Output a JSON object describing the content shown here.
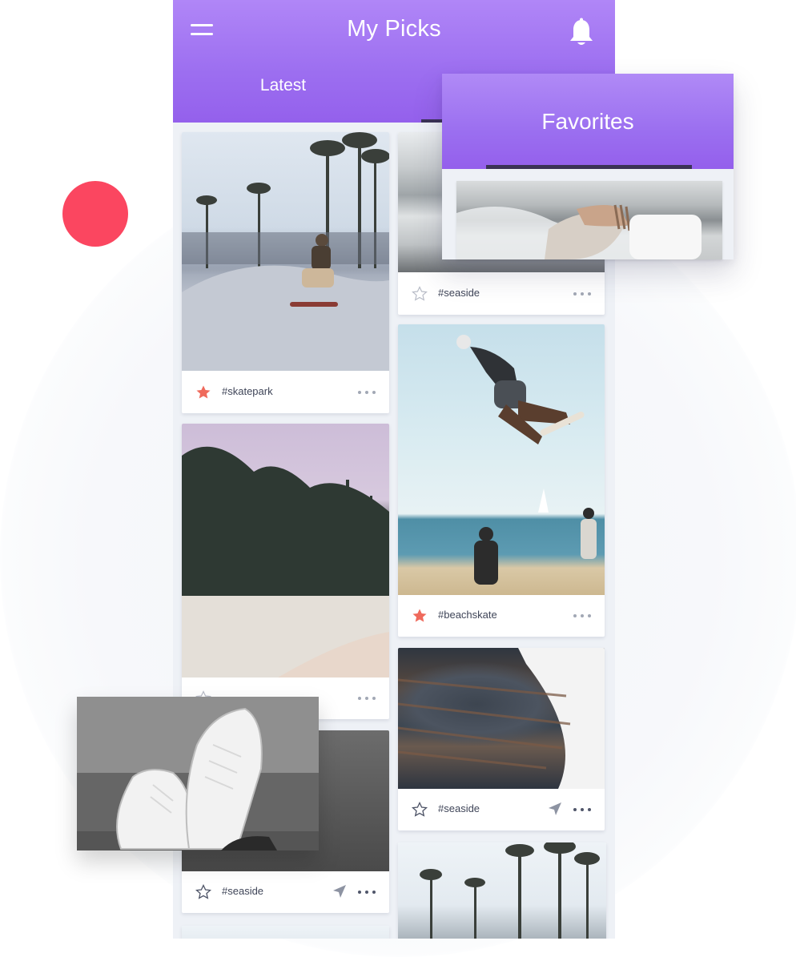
{
  "app": {
    "title": "My Picks",
    "tabs": {
      "latest": "Latest",
      "favorites": "Favorites"
    }
  },
  "icons": {
    "menu": "menu-icon",
    "bell": "bell-icon",
    "star_filled": "star-filled-icon",
    "star_outline": "star-outline-icon",
    "send": "send-icon",
    "more": "more-dots-icon"
  },
  "colors": {
    "header_gradient_top": "#b086f7",
    "header_gradient_bottom": "#9460ec",
    "accent_dot": "#fb4660",
    "star_filled": "#ef6a5c",
    "tab_indicator": "#3b3256"
  },
  "feed": {
    "left_column": [
      {
        "tag": "#skatepark",
        "starred": true
      },
      {
        "tag": "",
        "starred": false
      },
      {
        "tag": "#seaside",
        "starred": false
      }
    ],
    "right_column": [
      {
        "tag": "#seaside",
        "starred": false
      },
      {
        "tag": "#beachskate",
        "starred": true
      },
      {
        "tag": "#seaside",
        "starred": false
      }
    ]
  }
}
